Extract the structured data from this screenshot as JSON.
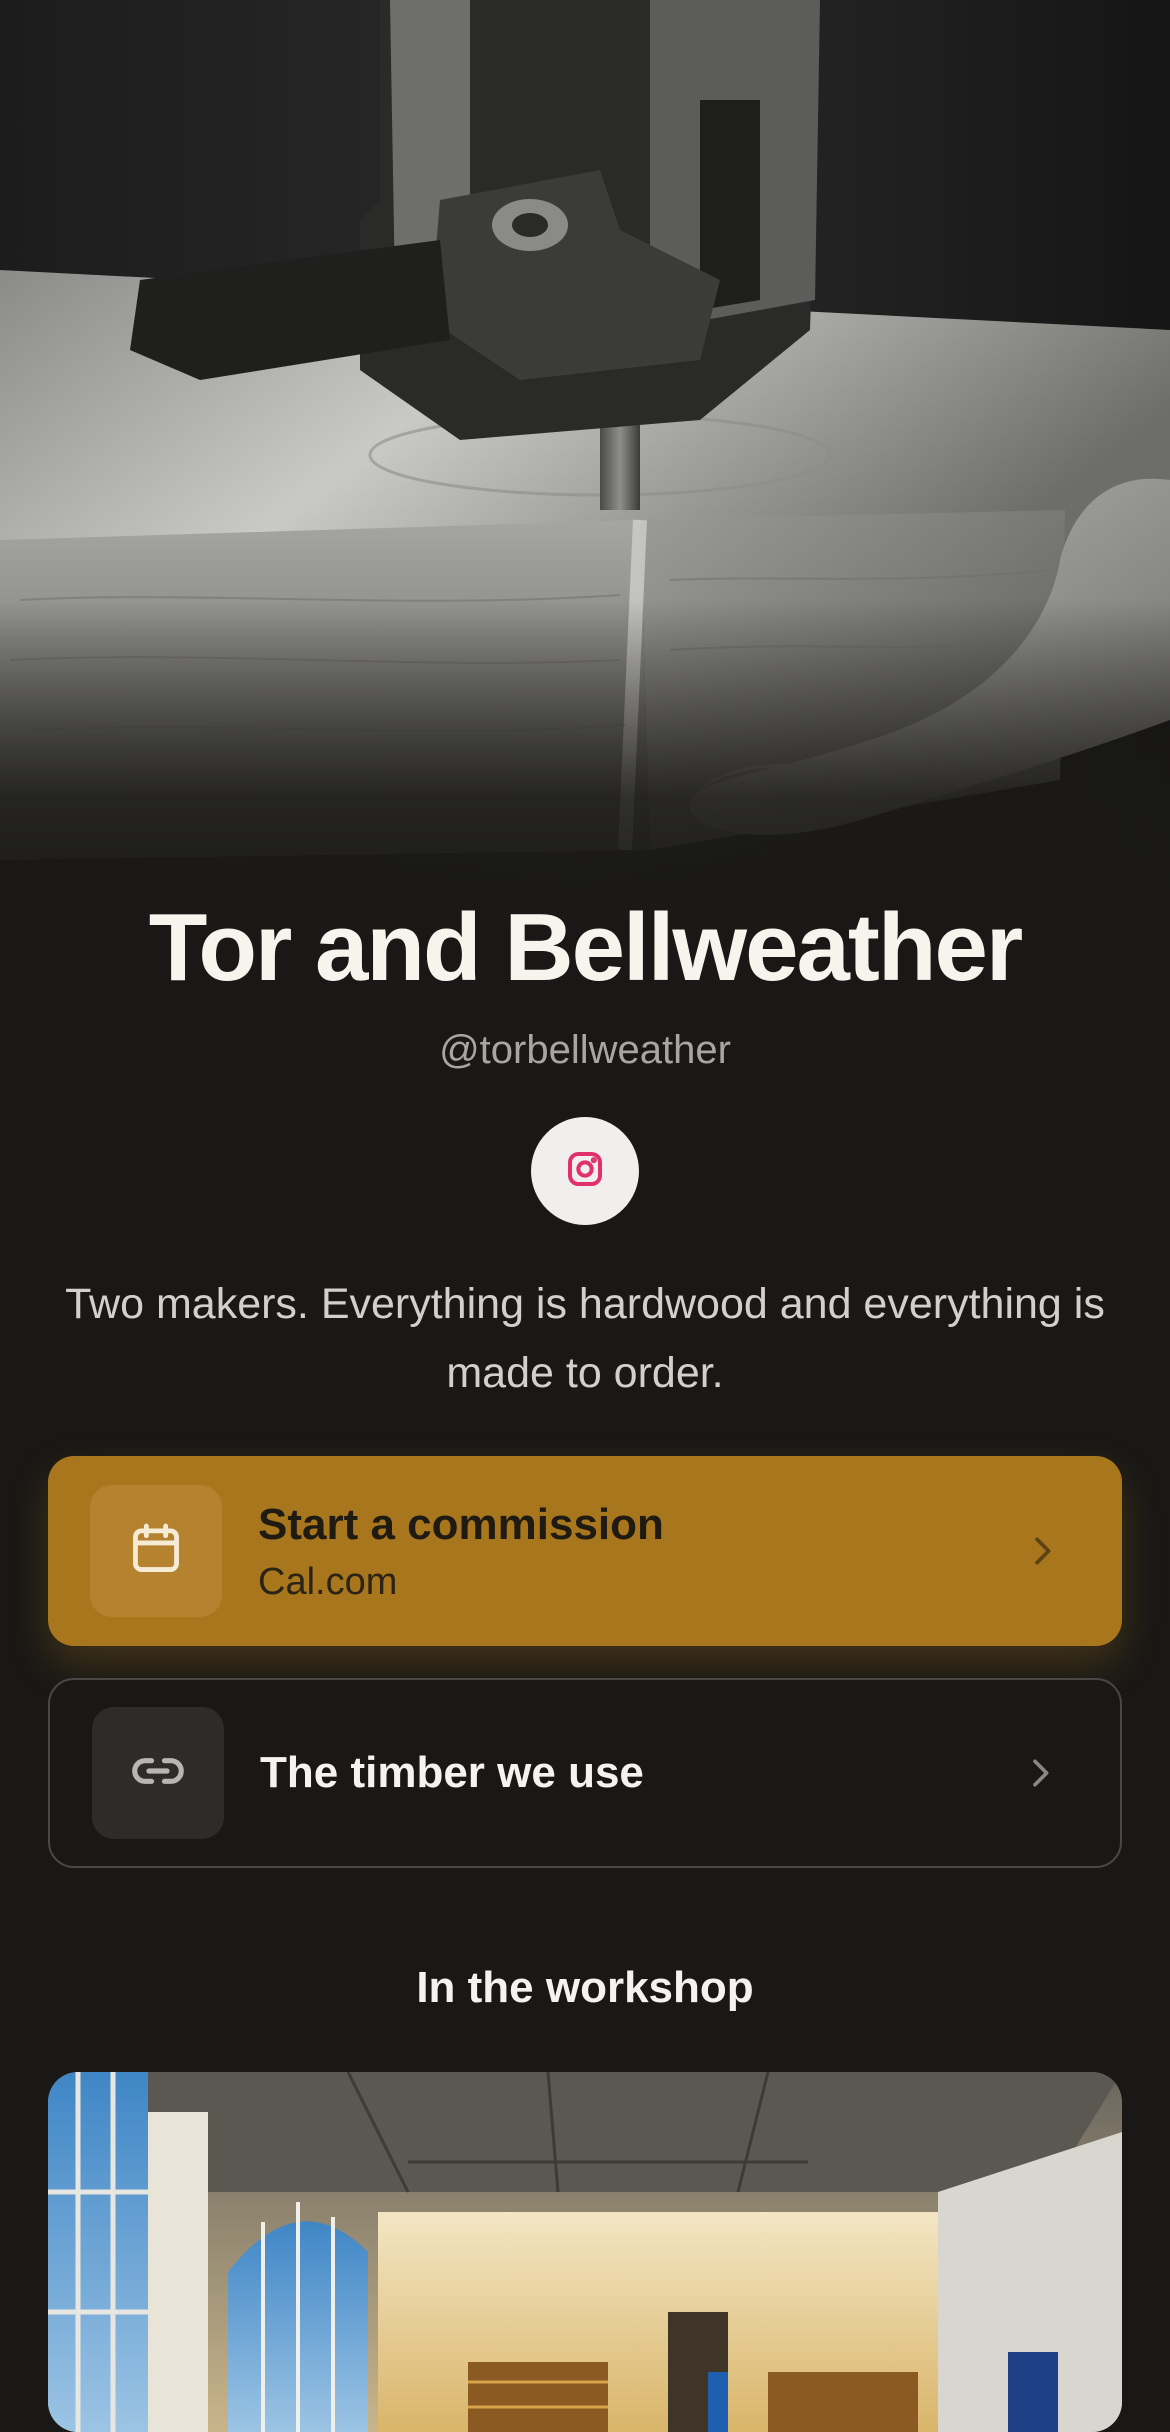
{
  "profile": {
    "name": "Tor and Bellweather",
    "handle": "@torbellweather",
    "bio": "Two makers. Everything is hardwood and everything is made to order."
  },
  "social": [
    {
      "icon": "instagram-icon",
      "color": "#e1306c"
    }
  ],
  "links": [
    {
      "title": "Start a commission",
      "subtitle": "Cal.com",
      "icon": "calendar-icon",
      "style": "primary",
      "accent": "#a8761c"
    },
    {
      "title": "The timber we use",
      "icon": "link-icon",
      "style": "secondary"
    }
  ],
  "sections": [
    {
      "heading": "In the workshop"
    }
  ],
  "theme": {
    "background": "#191816",
    "accent": "#a8761c",
    "text": "#f5f3ef"
  }
}
